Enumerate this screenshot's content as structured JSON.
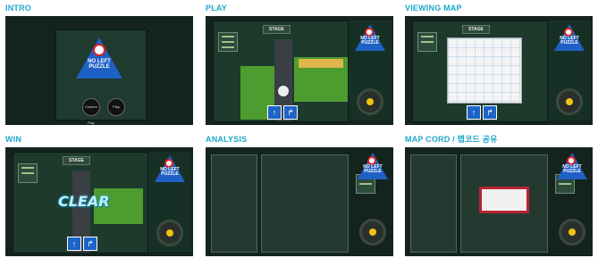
{
  "panels": [
    {
      "caption": "INTRO",
      "sign_text": "NO LEFT PUZZLE",
      "buttons": [
        "Custom Play",
        "Play"
      ]
    },
    {
      "caption": "PLAY",
      "stage_label": "STAGE",
      "sign_text": "NO LEFT PUZZLE"
    },
    {
      "caption": "VIEWING MAP",
      "stage_label": "STAGE",
      "sign_text": "NO LEFT PUZZLE"
    },
    {
      "caption": "WIN",
      "stage_label": "STAGE",
      "sign_text": "NO LEFT PUZZLE",
      "win_text": "CLEAR"
    },
    {
      "caption": "ANALYSIS",
      "sign_text": "NO LEFT PUZZLE"
    },
    {
      "caption": "MAP CORD / 맵코드 공유",
      "sign_text": "NO LEFT PUZZLE"
    }
  ],
  "colors": {
    "caption": "#1ea7c9",
    "board": "#1d3a2d",
    "sign": "#1f60c4",
    "grass": "#4d9c2f"
  },
  "icons": {
    "arrow_up": "arrow-up-icon",
    "turn_right": "turn-right-icon"
  }
}
